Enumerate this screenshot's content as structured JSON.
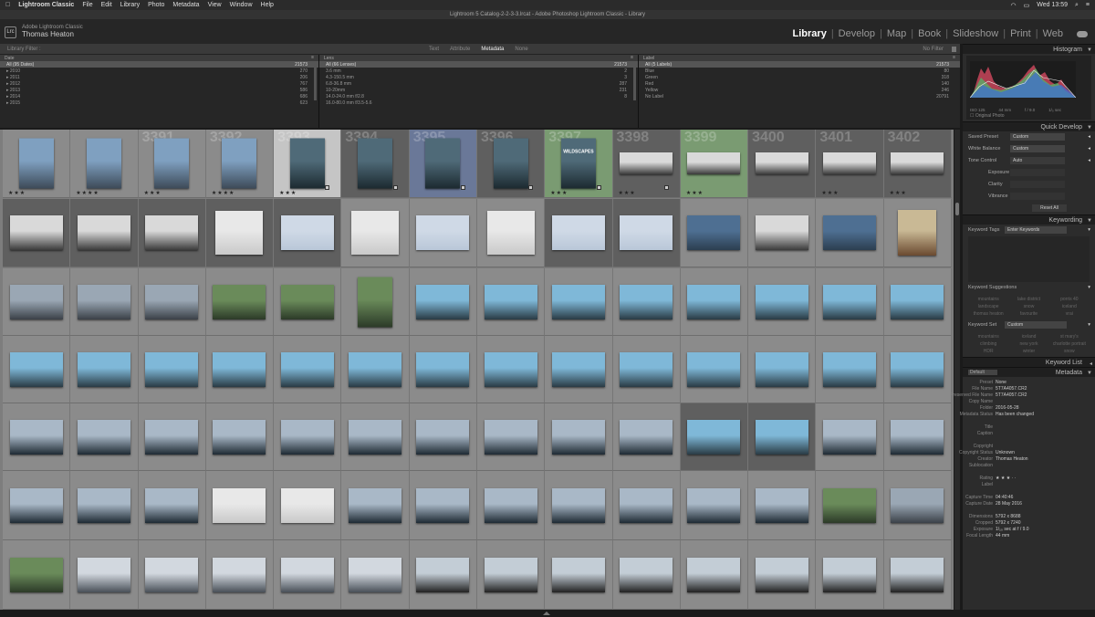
{
  "menubar": {
    "apple": "",
    "app": "Lightroom Classic",
    "items": [
      "File",
      "Edit",
      "Library",
      "Photo",
      "Metadata",
      "View",
      "Window",
      "Help"
    ],
    "clock": "Wed 13:59"
  },
  "window_title": "Lightroom 5 Catalog-2-2-3-3.lrcat - Adobe Photoshop Lightroom Classic - Library",
  "identity": {
    "badge": "Lrc",
    "product": "Adobe Lightroom Classic",
    "user": "Thomas Heaton"
  },
  "modules": [
    "Library",
    "Develop",
    "Map",
    "Book",
    "Slideshow",
    "Print",
    "Web"
  ],
  "active_module": "Library",
  "filter": {
    "label": "Library Filter :",
    "tabs": [
      "Text",
      "Attribute",
      "Metadata",
      "None"
    ],
    "active_tab": "Metadata",
    "preset": "No Filter"
  },
  "columns": [
    {
      "title": "Date",
      "rows": [
        {
          "label": "All (95 Dates)",
          "count": "21573"
        },
        {
          "label": "▸ 2010",
          "count": "270"
        },
        {
          "label": "▸ 2011",
          "count": "206"
        },
        {
          "label": "▸ 2012",
          "count": "767"
        },
        {
          "label": "▸ 2013",
          "count": "586"
        },
        {
          "label": "▸ 2014",
          "count": "686"
        },
        {
          "label": "▸ 2015",
          "count": "623"
        }
      ]
    },
    {
      "title": "Lens",
      "rows": [
        {
          "label": "All (66 Lenses)",
          "count": "21573"
        },
        {
          "label": "3.6 mm",
          "count": "2"
        },
        {
          "label": "4.3-150.5 mm",
          "count": "3"
        },
        {
          "label": "6.8-36.8 mm",
          "count": "287"
        },
        {
          "label": "10-20mm",
          "count": "231"
        },
        {
          "label": "14.0-24.0 mm f/2.8",
          "count": "8"
        },
        {
          "label": "16.0-80.0 mm f/3.5-5.6",
          "count": ""
        }
      ]
    },
    {
      "title": "Label",
      "rows": [
        {
          "label": "All (5 Labels)",
          "count": "21573"
        },
        {
          "label": "Blue",
          "count": "80"
        },
        {
          "label": "Green",
          "count": "318"
        },
        {
          "label": "Red",
          "count": "140"
        },
        {
          "label": "Yellow",
          "count": "246"
        },
        {
          "label": "No Label",
          "count": "20791"
        }
      ]
    }
  ],
  "grid_numbers": [
    "3391",
    "3392",
    "3393",
    "3394",
    "3395",
    "3396",
    "3397",
    "3398",
    "3399",
    "3400",
    "3401",
    "3402"
  ],
  "watermark_text": "WILDSCAPES",
  "panel": {
    "histogram": "Histogram",
    "histo_info": [
      "ISO 125",
      "44 mm",
      "f / 9.0",
      "1/₀ sec"
    ],
    "original_photo": "Original Photo",
    "quick_develop": "Quick Develop",
    "saved_preset": {
      "label": "Saved Preset",
      "value": "Custom"
    },
    "white_balance": {
      "label": "White Balance",
      "value": "Custom"
    },
    "tone_control": {
      "label": "Tone Control",
      "value": "Auto"
    },
    "tone_sliders": [
      "Exposure",
      "Clarity",
      "Vibrance"
    ],
    "reset_all": "Reset All",
    "keywording": "Keywording",
    "keyword_tags": {
      "label": "Keyword Tags",
      "value": "Enter Keywords"
    },
    "keyword_suggestions": "Keyword Suggestions",
    "suggestions": [
      "mountains",
      "lake district",
      "porris 40",
      "landscape",
      "snow",
      "iceland",
      "thomas heaton",
      "favourite",
      "vrai"
    ],
    "keyword_set": {
      "label": "Keyword Set",
      "value": "Custom"
    },
    "set_chips": [
      "mountains",
      "iceland",
      "st mary's",
      "climbing",
      "new york",
      "charlotte portrait",
      "HDR",
      "winter",
      "snow"
    ],
    "keyword_list": "Keyword List",
    "metadata": "Metadata",
    "metadata_preset_dropdown": "Default",
    "metadata_rows": [
      {
        "k": "Preset",
        "v": "None"
      },
      {
        "k": "File Name",
        "v": "5T7A4057.CR2"
      },
      {
        "k": "Preserved File Name",
        "v": "5T7A4057.CR2"
      },
      {
        "k": "Copy Name",
        "v": ""
      },
      {
        "k": "Folder",
        "v": "2016-05-28"
      },
      {
        "k": "Metadata Status",
        "v": "Has been changed"
      },
      {
        "k": "",
        "v": ""
      },
      {
        "k": "Title",
        "v": ""
      },
      {
        "k": "Caption",
        "v": ""
      },
      {
        "k": "",
        "v": ""
      },
      {
        "k": "Copyright",
        "v": ""
      },
      {
        "k": "Copyright Status",
        "v": "Unknown"
      },
      {
        "k": "Creator",
        "v": "Thomas Heaton"
      },
      {
        "k": "Sublocation",
        "v": ""
      },
      {
        "k": "",
        "v": ""
      },
      {
        "k": "Rating",
        "v": "★ ★ ★ · ·"
      },
      {
        "k": "Label",
        "v": ""
      },
      {
        "k": "",
        "v": ""
      },
      {
        "k": "Capture Time",
        "v": "04:40:46"
      },
      {
        "k": "Capture Date",
        "v": "28 May 2016"
      },
      {
        "k": "",
        "v": ""
      },
      {
        "k": "Dimensions",
        "v": "5792 x 8688"
      },
      {
        "k": "Cropped",
        "v": "5792 x 7240"
      },
      {
        "k": "Exposure",
        "v": "1/₁₀ sec at f / 9.0"
      },
      {
        "k": "Focal Length",
        "v": "44 mm"
      }
    ]
  }
}
